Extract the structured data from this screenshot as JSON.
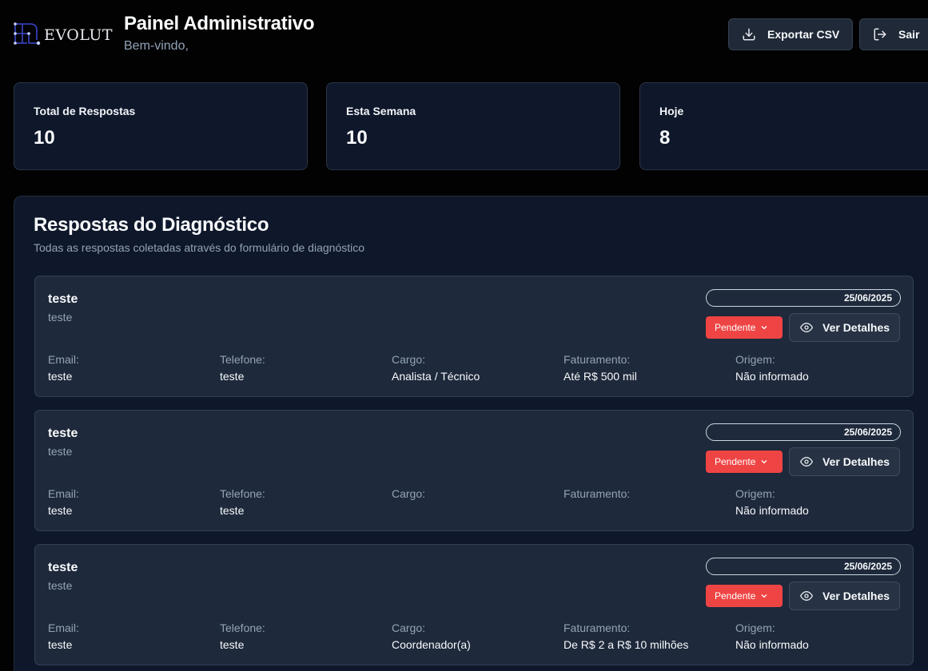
{
  "brand": {
    "logo_text": "EVOLUT"
  },
  "header": {
    "title": "Painel Administrativo",
    "subtitle": "Bem-vindo,",
    "export_label": "Exportar CSV",
    "logout_label": "Sair"
  },
  "stats": [
    {
      "label": "Total de Respostas",
      "value": "10"
    },
    {
      "label": "Esta Semana",
      "value": "10"
    },
    {
      "label": "Hoje",
      "value": "8"
    }
  ],
  "responses": {
    "title": "Respostas do Diagnóstico",
    "description": "Todas as respostas coletadas através do formulário de diagnóstico",
    "field_labels": {
      "email": "Email:",
      "phone": "Telefone:",
      "role": "Cargo:",
      "revenue": "Faturamento:",
      "origin": "Origem:"
    },
    "details_label": "Ver Detalhes",
    "items": [
      {
        "name": "teste",
        "company": "teste",
        "date": "25/06/2025",
        "status": "Pendente",
        "email": "teste",
        "phone": "teste",
        "role": "Analista / Técnico",
        "revenue": "Até R$ 500 mil",
        "origin": "Não informado"
      },
      {
        "name": "teste",
        "company": "teste",
        "date": "25/06/2025",
        "status": "Pendente",
        "email": "teste",
        "phone": "teste",
        "role": "",
        "revenue": "",
        "origin": "Não informado"
      },
      {
        "name": "teste",
        "company": "teste",
        "date": "25/06/2025",
        "status": "Pendente",
        "email": "teste",
        "phone": "teste",
        "role": "Coordenador(a)",
        "revenue": "De R$ 2 a R$ 10 milhões",
        "origin": "Não informado"
      }
    ]
  },
  "colors": {
    "background": "#020203",
    "card": "#0f172a",
    "entry": "#1e293b",
    "status_pending": "#ef4444",
    "muted_text": "#94a3b8"
  },
  "icons": {
    "logo": "evolut-network-icon",
    "export": "download-icon",
    "logout": "logout-icon",
    "status": "chevron-down-icon",
    "details": "eye-icon"
  }
}
